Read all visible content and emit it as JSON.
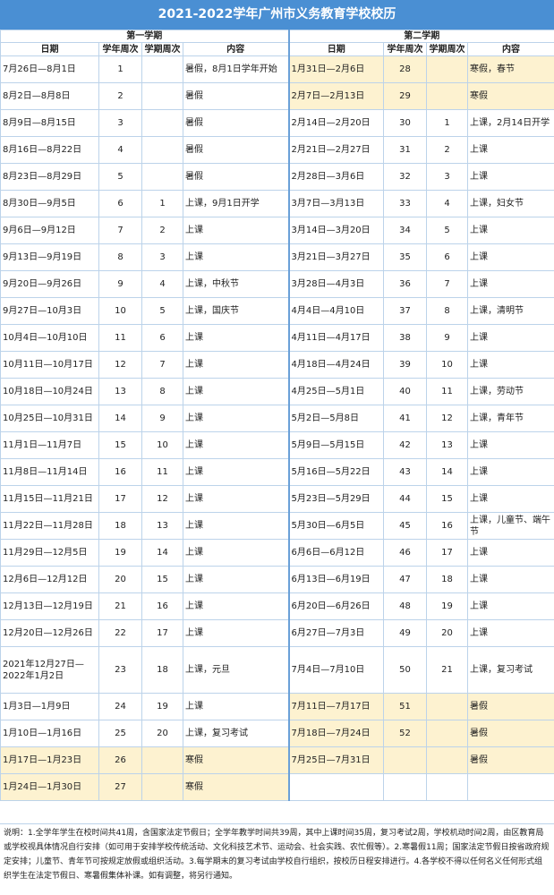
{
  "title": "2021-2022学年广州市义务教育学校校历",
  "sem1_header": "第一学期",
  "sem2_header": "第二学期",
  "cols": {
    "date": "日期",
    "year_week": "学年周次",
    "sem_week": "学期周次",
    "content": "内容"
  },
  "rows": [
    {
      "d1": "7月26日—8月1日",
      "y1": "1",
      "s1": "",
      "c1": "暑假，8月1日学年开始",
      "h1": false,
      "d2": "1月31日—2月6日",
      "y2": "28",
      "s2": "",
      "c2": "寒假，春节",
      "h2": true
    },
    {
      "d1": "8月2日—8月8日",
      "y1": "2",
      "s1": "",
      "c1": "暑假",
      "h1": false,
      "d2": "2月7日—2月13日",
      "y2": "29",
      "s2": "",
      "c2": "寒假",
      "h2": true
    },
    {
      "d1": "8月9日—8月15日",
      "y1": "3",
      "s1": "",
      "c1": "暑假",
      "h1": false,
      "d2": "2月14日—2月20日",
      "y2": "30",
      "s2": "1",
      "c2": "上课，2月14日开学",
      "h2": false
    },
    {
      "d1": "8月16日—8月22日",
      "y1": "4",
      "s1": "",
      "c1": "暑假",
      "h1": false,
      "d2": "2月21日—2月27日",
      "y2": "31",
      "s2": "2",
      "c2": "上课",
      "h2": false
    },
    {
      "d1": "8月23日—8月29日",
      "y1": "5",
      "s1": "",
      "c1": "暑假",
      "h1": false,
      "d2": "2月28日—3月6日",
      "y2": "32",
      "s2": "3",
      "c2": "上课",
      "h2": false
    },
    {
      "d1": "8月30日—9月5日",
      "y1": "6",
      "s1": "1",
      "c1": "上课，9月1日开学",
      "h1": false,
      "d2": "3月7日—3月13日",
      "y2": "33",
      "s2": "4",
      "c2": "上课，妇女节",
      "h2": false
    },
    {
      "d1": "9月6日—9月12日",
      "y1": "7",
      "s1": "2",
      "c1": "上课",
      "h1": false,
      "d2": "3月14日—3月20日",
      "y2": "34",
      "s2": "5",
      "c2": "上课",
      "h2": false
    },
    {
      "d1": "9月13日—9月19日",
      "y1": "8",
      "s1": "3",
      "c1": "上课",
      "h1": false,
      "d2": "3月21日—3月27日",
      "y2": "35",
      "s2": "6",
      "c2": "上课",
      "h2": false
    },
    {
      "d1": "9月20日—9月26日",
      "y1": "9",
      "s1": "4",
      "c1": "上课，中秋节",
      "h1": false,
      "d2": "3月28日—4月3日",
      "y2": "36",
      "s2": "7",
      "c2": "上课",
      "h2": false
    },
    {
      "d1": "9月27日—10月3日",
      "y1": "10",
      "s1": "5",
      "c1": "上课，国庆节",
      "h1": false,
      "d2": "4月4日—4月10日",
      "y2": "37",
      "s2": "8",
      "c2": "上课，清明节",
      "h2": false
    },
    {
      "d1": "10月4日—10月10日",
      "y1": "11",
      "s1": "6",
      "c1": "上课",
      "h1": false,
      "d2": "4月11日—4月17日",
      "y2": "38",
      "s2": "9",
      "c2": "上课",
      "h2": false
    },
    {
      "d1": "10月11日—10月17日",
      "y1": "12",
      "s1": "7",
      "c1": "上课",
      "h1": false,
      "d2": "4月18日—4月24日",
      "y2": "39",
      "s2": "10",
      "c2": "上课",
      "h2": false
    },
    {
      "d1": "10月18日—10月24日",
      "y1": "13",
      "s1": "8",
      "c1": "上课",
      "h1": false,
      "d2": "4月25日—5月1日",
      "y2": "40",
      "s2": "11",
      "c2": "上课，劳动节",
      "h2": false
    },
    {
      "d1": "10月25日—10月31日",
      "y1": "14",
      "s1": "9",
      "c1": "上课",
      "h1": false,
      "d2": "5月2日—5月8日",
      "y2": "41",
      "s2": "12",
      "c2": "上课，青年节",
      "h2": false
    },
    {
      "d1": "11月1日—11月7日",
      "y1": "15",
      "s1": "10",
      "c1": "上课",
      "h1": false,
      "d2": "5月9日—5月15日",
      "y2": "42",
      "s2": "13",
      "c2": "上课",
      "h2": false
    },
    {
      "d1": "11月8日—11月14日",
      "y1": "16",
      "s1": "11",
      "c1": "上课",
      "h1": false,
      "d2": "5月16日—5月22日",
      "y2": "43",
      "s2": "14",
      "c2": "上课",
      "h2": false
    },
    {
      "d1": "11月15日—11月21日",
      "y1": "17",
      "s1": "12",
      "c1": "上课",
      "h1": false,
      "d2": "5月23日—5月29日",
      "y2": "44",
      "s2": "15",
      "c2": "上课",
      "h2": false
    },
    {
      "d1": "11月22日—11月28日",
      "y1": "18",
      "s1": "13",
      "c1": "上课",
      "h1": false,
      "d2": "5月30日—6月5日",
      "y2": "45",
      "s2": "16",
      "c2": "上课，儿童节、端午节",
      "h2": false
    },
    {
      "d1": "11月29日—12月5日",
      "y1": "19",
      "s1": "14",
      "c1": "上课",
      "h1": false,
      "d2": "6月6日—6月12日",
      "y2": "46",
      "s2": "17",
      "c2": "上课",
      "h2": false
    },
    {
      "d1": "12月6日—12月12日",
      "y1": "20",
      "s1": "15",
      "c1": "上课",
      "h1": false,
      "d2": "6月13日—6月19日",
      "y2": "47",
      "s2": "18",
      "c2": "上课",
      "h2": false
    },
    {
      "d1": "12月13日—12月19日",
      "y1": "21",
      "s1": "16",
      "c1": "上课",
      "h1": false,
      "d2": "6月20日—6月26日",
      "y2": "48",
      "s2": "19",
      "c2": "上课",
      "h2": false
    },
    {
      "d1": "12月20日—12月26日",
      "y1": "22",
      "s1": "17",
      "c1": "上课",
      "h1": false,
      "d2": "6月27日—7月3日",
      "y2": "49",
      "s2": "20",
      "c2": "上课",
      "h2": false
    },
    {
      "d1": "2021年12月27日—2022年1月2日",
      "y1": "23",
      "s1": "18",
      "c1": "上课，元旦",
      "h1": false,
      "d2": "7月4日—7月10日",
      "y2": "50",
      "s2": "21",
      "c2": "上课，复习考试",
      "h2": false,
      "tall": true
    },
    {
      "d1": "1月3日—1月9日",
      "y1": "24",
      "s1": "19",
      "c1": "上课",
      "h1": false,
      "d2": "7月11日—7月17日",
      "y2": "51",
      "s2": "",
      "c2": "暑假",
      "h2": true
    },
    {
      "d1": "1月10日—1月16日",
      "y1": "25",
      "s1": "20",
      "c1": "上课，复习考试",
      "h1": false,
      "d2": "7月18日—7月24日",
      "y2": "52",
      "s2": "",
      "c2": "暑假",
      "h2": true
    },
    {
      "d1": "1月17日—1月23日",
      "y1": "26",
      "s1": "",
      "c1": "寒假",
      "h1": true,
      "d2": "7月25日—7月31日",
      "y2": "",
      "s2": "",
      "c2": "暑假",
      "h2": true
    },
    {
      "d1": "1月24日—1月30日",
      "y1": "27",
      "s1": "",
      "c1": "寒假",
      "h1": true,
      "d2": "",
      "y2": "",
      "s2": "",
      "c2": "",
      "h2": false,
      "blank2": true
    }
  ],
  "notes": "说明：1.全学年学生在校时间共41周，含国家法定节假日；全学年教学时间共39周，其中上课时间35周，复习考试2周，学校机动时间2周，由区教育局或学校视具体情况自行安排（如可用于安排学校传统活动、文化科技艺术节、运动会、社会实践、农忙假等）。2.寒暑假11周；国家法定节假日按省政府规定安排；儿童节、青年节可按规定放假或组织活动。3.每学期末的复习考试由学校自行组织，按校历日程安排进行。4.各学校不得以任何名义任何形式组织学生在法定节假日、寒暑假集体补课。如有调整，将另行通知。"
}
